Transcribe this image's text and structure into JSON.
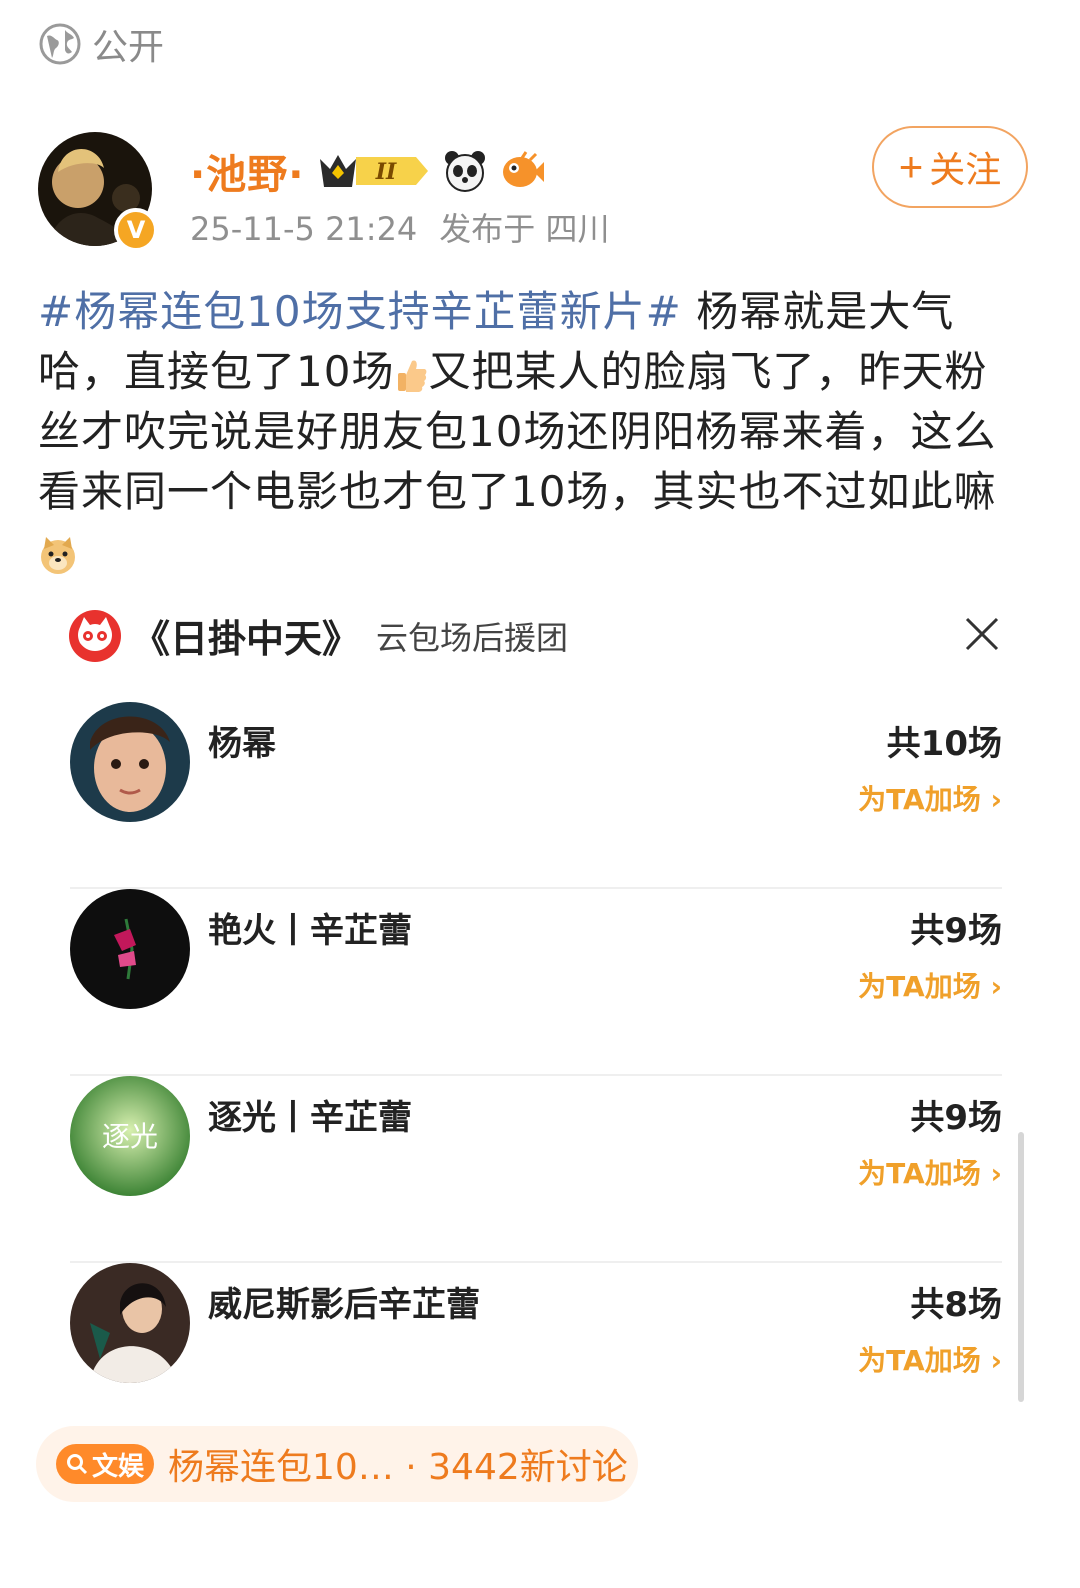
{
  "visibility": {
    "icon": "globe-icon",
    "label": "公开"
  },
  "author": {
    "name": "·池野·",
    "verified_icon": "verified-v-icon",
    "badges": [
      "crown-level-badge",
      "panda-icon",
      "pufferfish-icon"
    ],
    "crown_level": "II",
    "timestamp": "25-11-5 21:24",
    "location": "发布于 四川",
    "follow_label": "关注"
  },
  "post": {
    "hashtag": "#杨幂连包10场支持辛芷蕾新片#",
    "text_1": "杨幂就是大气哈，直接包了10场",
    "emoji_1": "thumbs-up-icon",
    "text_2": "又把某人的脸扇飞了，昨天粉丝才吹完说是好朋友包10场还阴阳杨幂来着，这么看来同一个电影也才包了10场，其实也不过如此嘛",
    "emoji_2": "doge-icon"
  },
  "card": {
    "logo_icon": "maoyan-cat-icon",
    "title": "《日掛中天》",
    "subtitle": "云包场后援团",
    "rows": [
      {
        "name": "杨幂",
        "count": "共10场",
        "action": "为TA加场",
        "avatar_color": "#8a5a3a"
      },
      {
        "name": "艳火丨辛芷蕾",
        "count": "共9场",
        "action": "为TA加场",
        "avatar_color": "#0e0e0e"
      },
      {
        "name": "逐光丨辛芷蕾",
        "count": "共9场",
        "action": "为TA加场",
        "avatar_color": "#4a8a2e",
        "avatar_text": "逐光"
      },
      {
        "name": "威尼斯影后辛芷蕾",
        "count": "共8场",
        "action": "为TA加场",
        "avatar_color": "#3a2a24"
      }
    ]
  },
  "discussion": {
    "tag": "文娱",
    "text": "杨幂连包10… · 3442新讨论"
  },
  "colors": {
    "accent": "#ee7b1e",
    "hashtag": "#4f6fa6",
    "action": "#f0a02a"
  }
}
